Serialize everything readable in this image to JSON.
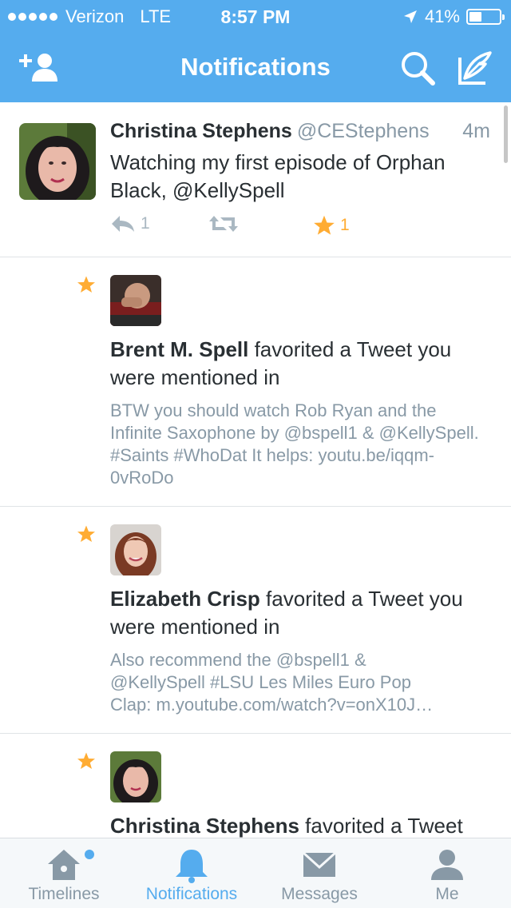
{
  "status_bar": {
    "carrier": "Verizon",
    "network": "LTE",
    "time": "8:57 PM",
    "battery_text": "41%",
    "battery_level": 0.41
  },
  "nav": {
    "title": "Notifications",
    "left_icon": "add-user-icon",
    "right_icons": [
      "search-icon",
      "compose-icon"
    ]
  },
  "tweet": {
    "name": "Christina Stephens",
    "handle": "@CEStephens",
    "time": "4m",
    "text": "Watching my first episode of Orphan Black, @KellySpell",
    "reply_count": "1",
    "fav_count": "1"
  },
  "notifications": [
    {
      "actor": "Brent M. Spell",
      "action": " favorited a Tweet you were mentioned in",
      "quote": "BTW you should watch Rob Ryan and the Infinite Saxophone by @bspell1 & @KellySpell. #Saints #WhoDat It helps: youtu.be/iqqm-0vRoDo"
    },
    {
      "actor": "Elizabeth Crisp",
      "action": " favorited a Tweet you were mentioned in",
      "quote_lines": [
        "Also recommend the @bspell1 &",
        "@KellySpell #LSU Les Miles Euro Pop",
        "Clap: m.youtube.com/watch?v=onX10J…"
      ]
    },
    {
      "actor": "Christina Stephens",
      "action": " favorited a Tweet"
    }
  ],
  "tabs": [
    {
      "label": "Timelines",
      "icon": "home-icon"
    },
    {
      "label": "Notifications",
      "icon": "bell-icon"
    },
    {
      "label": "Messages",
      "icon": "envelope-icon"
    },
    {
      "label": "Me",
      "icon": "person-icon"
    }
  ],
  "colors": {
    "brand": "#55acee",
    "favorite": "#ffac33",
    "muted": "#8899a6"
  }
}
